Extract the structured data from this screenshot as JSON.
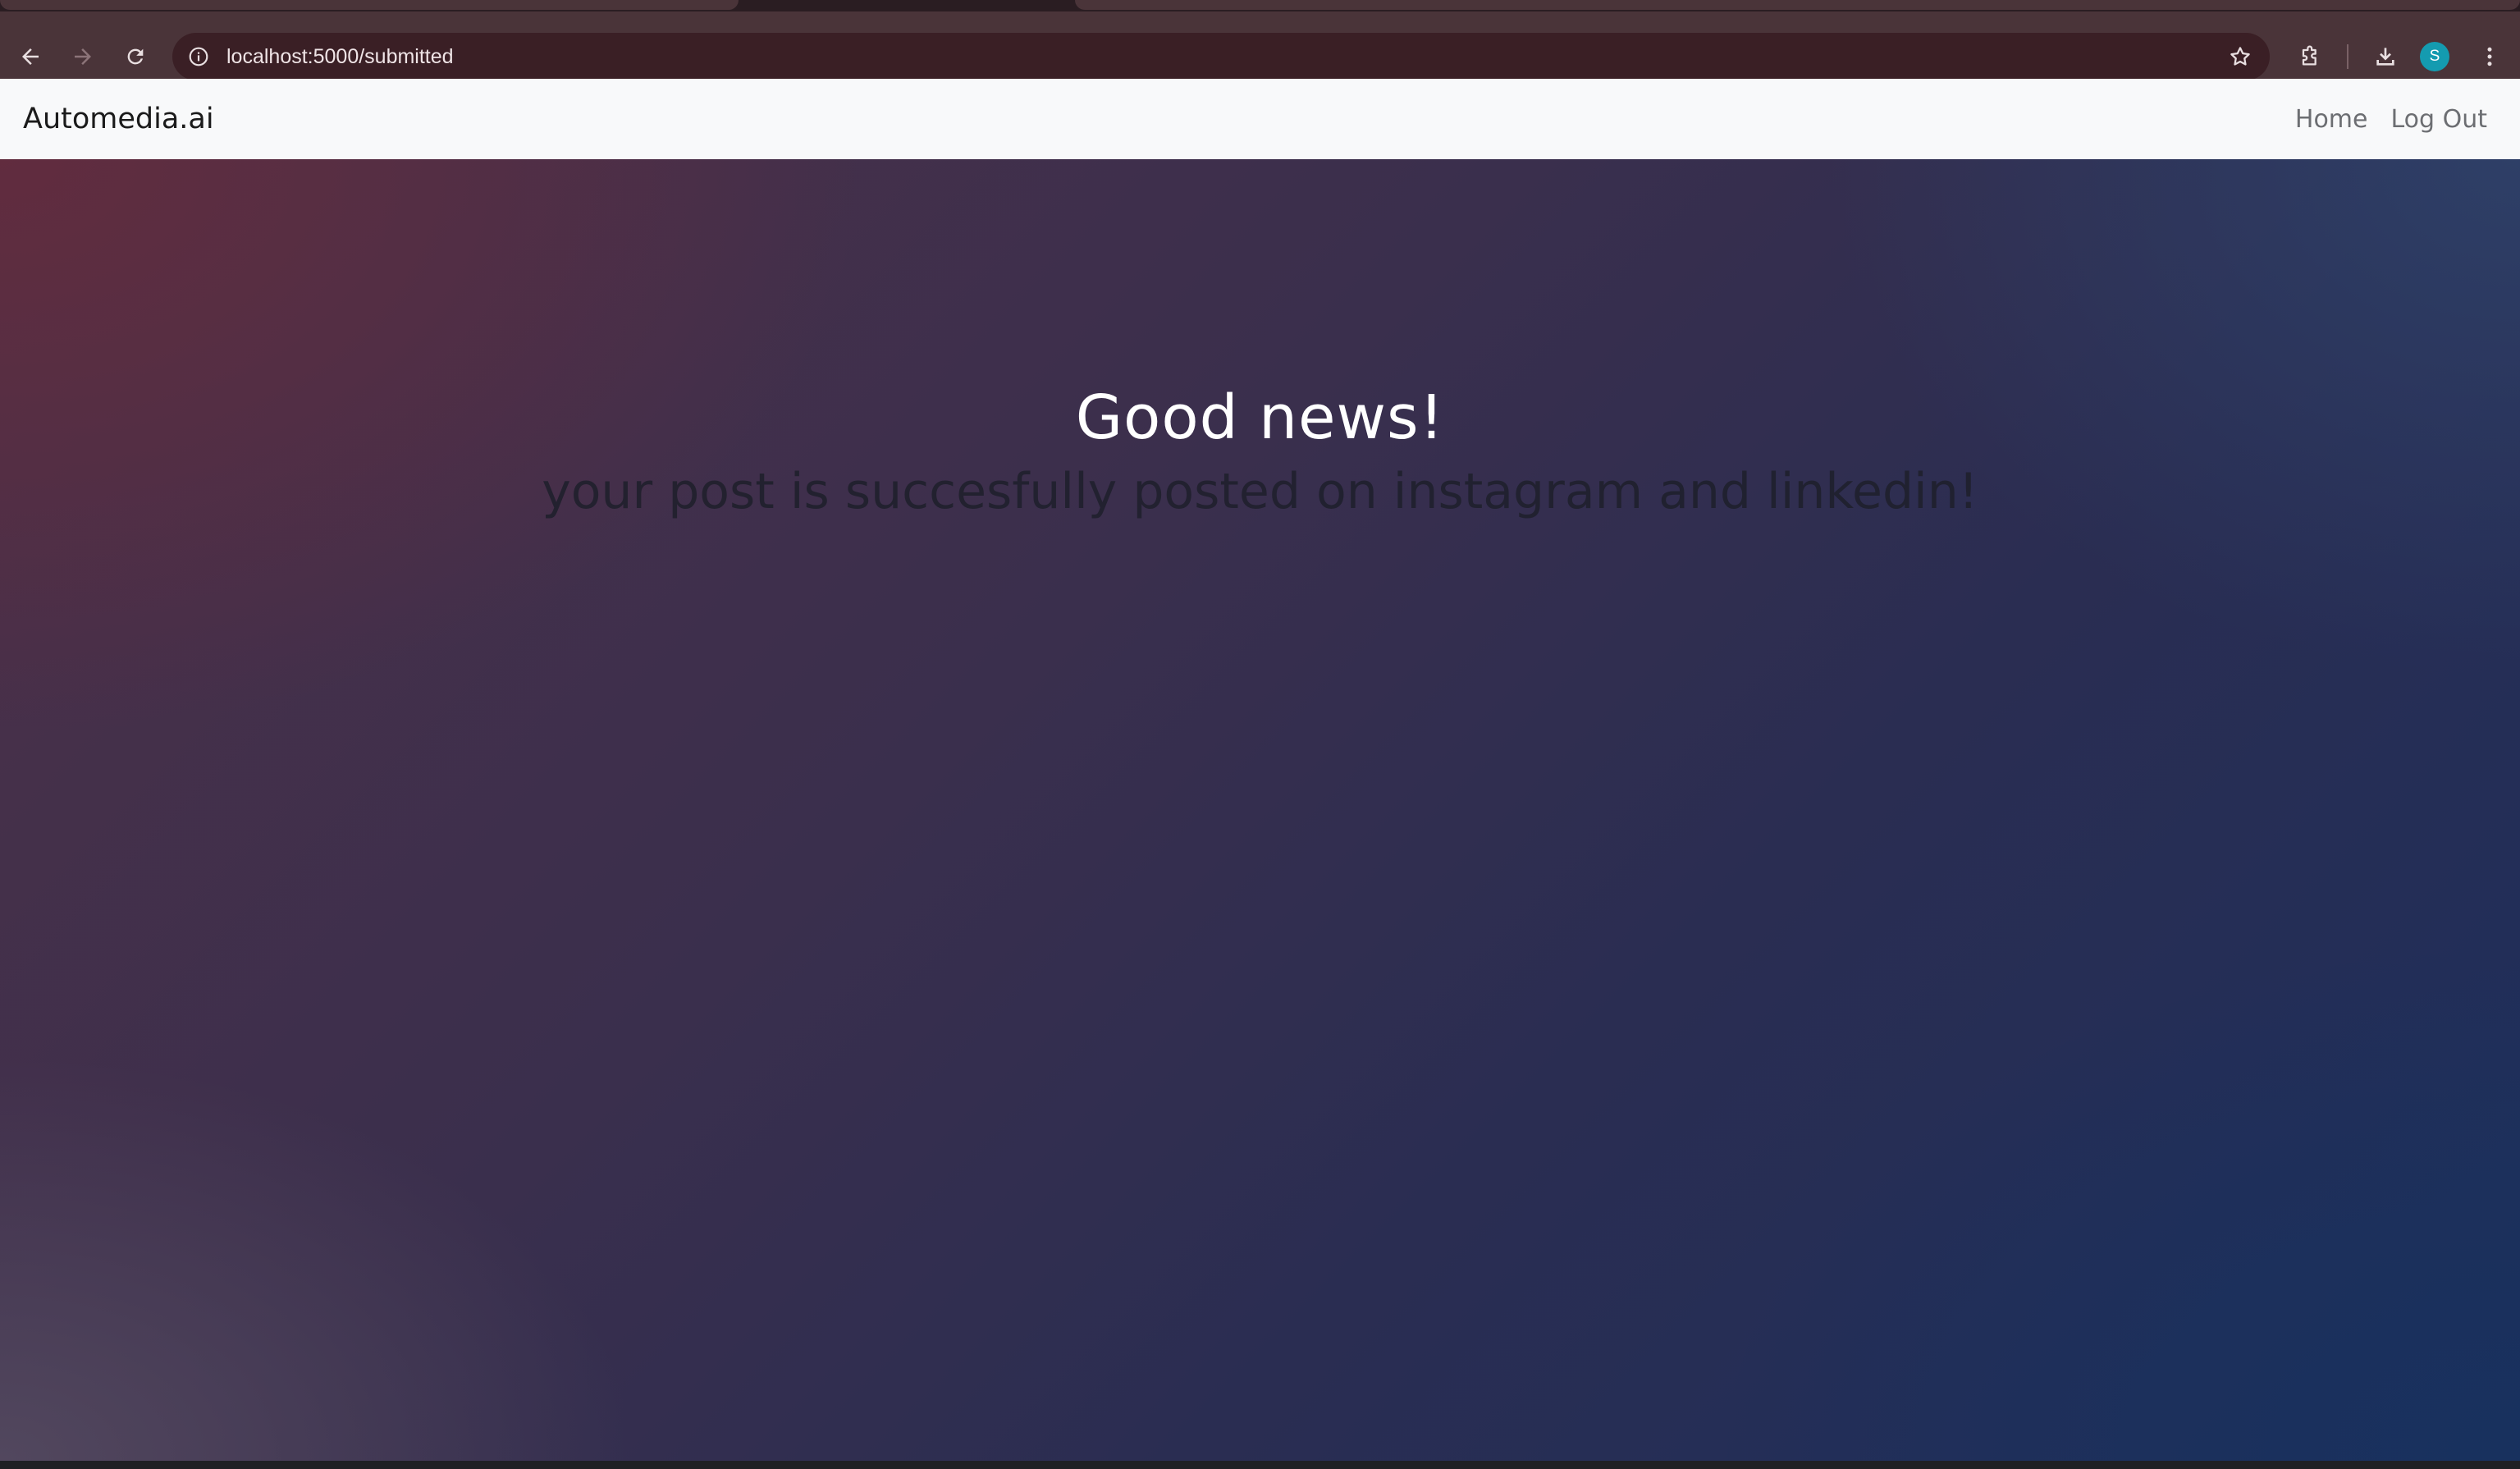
{
  "browser": {
    "url": "localhost:5000/submitted",
    "avatar_initial": "S"
  },
  "navbar": {
    "brand": "Automedia.ai",
    "links": [
      "Home",
      "Log Out"
    ]
  },
  "hero": {
    "title": "Good news!",
    "subtitle": "your post is succesfully posted on instagram and linkedin!"
  },
  "colors": {
    "navbar_bg": "#f8f9fa",
    "chrome_bg": "#4a3439",
    "omnibox_bg": "#3a1f25",
    "avatar": "#149bb0",
    "hero_gradient_start": "#5e2c3e",
    "hero_gradient_end": "#18315e"
  }
}
